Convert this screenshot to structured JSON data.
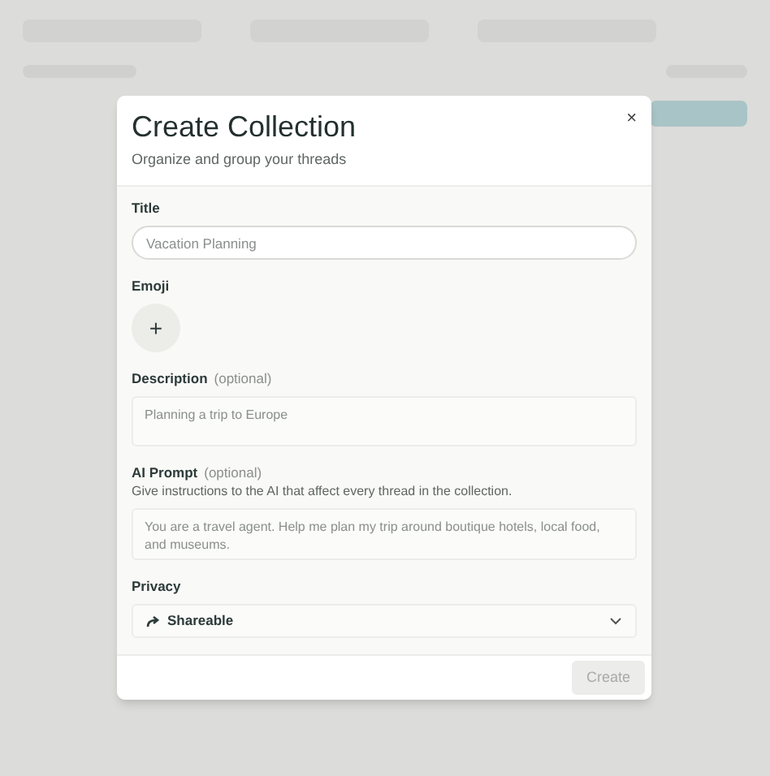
{
  "dialog": {
    "title": "Create Collection",
    "subtitle": "Organize and group your threads",
    "close": "×"
  },
  "fields": [
    {
      "kind": "input",
      "label": "Title",
      "placeholder": "Vacation Planning"
    },
    {
      "kind": "emoji",
      "label": "Emoji",
      "button": "+"
    },
    {
      "kind": "textarea",
      "label": "Description",
      "optional": "(optional)",
      "placeholder": "Planning a trip to Europe"
    },
    {
      "kind": "textarea",
      "label": "AI Prompt",
      "optional": "(optional)",
      "hint": "Give instructions to the AI that affect every thread in the collection.",
      "placeholder": "You are a travel agent. Help me plan my trip around boutique hotels, local food, and museums."
    },
    {
      "kind": "select",
      "label": "Privacy",
      "value": "Shareable"
    }
  ],
  "footer": {
    "create": {
      "label": "Create",
      "disabled": true
    }
  }
}
